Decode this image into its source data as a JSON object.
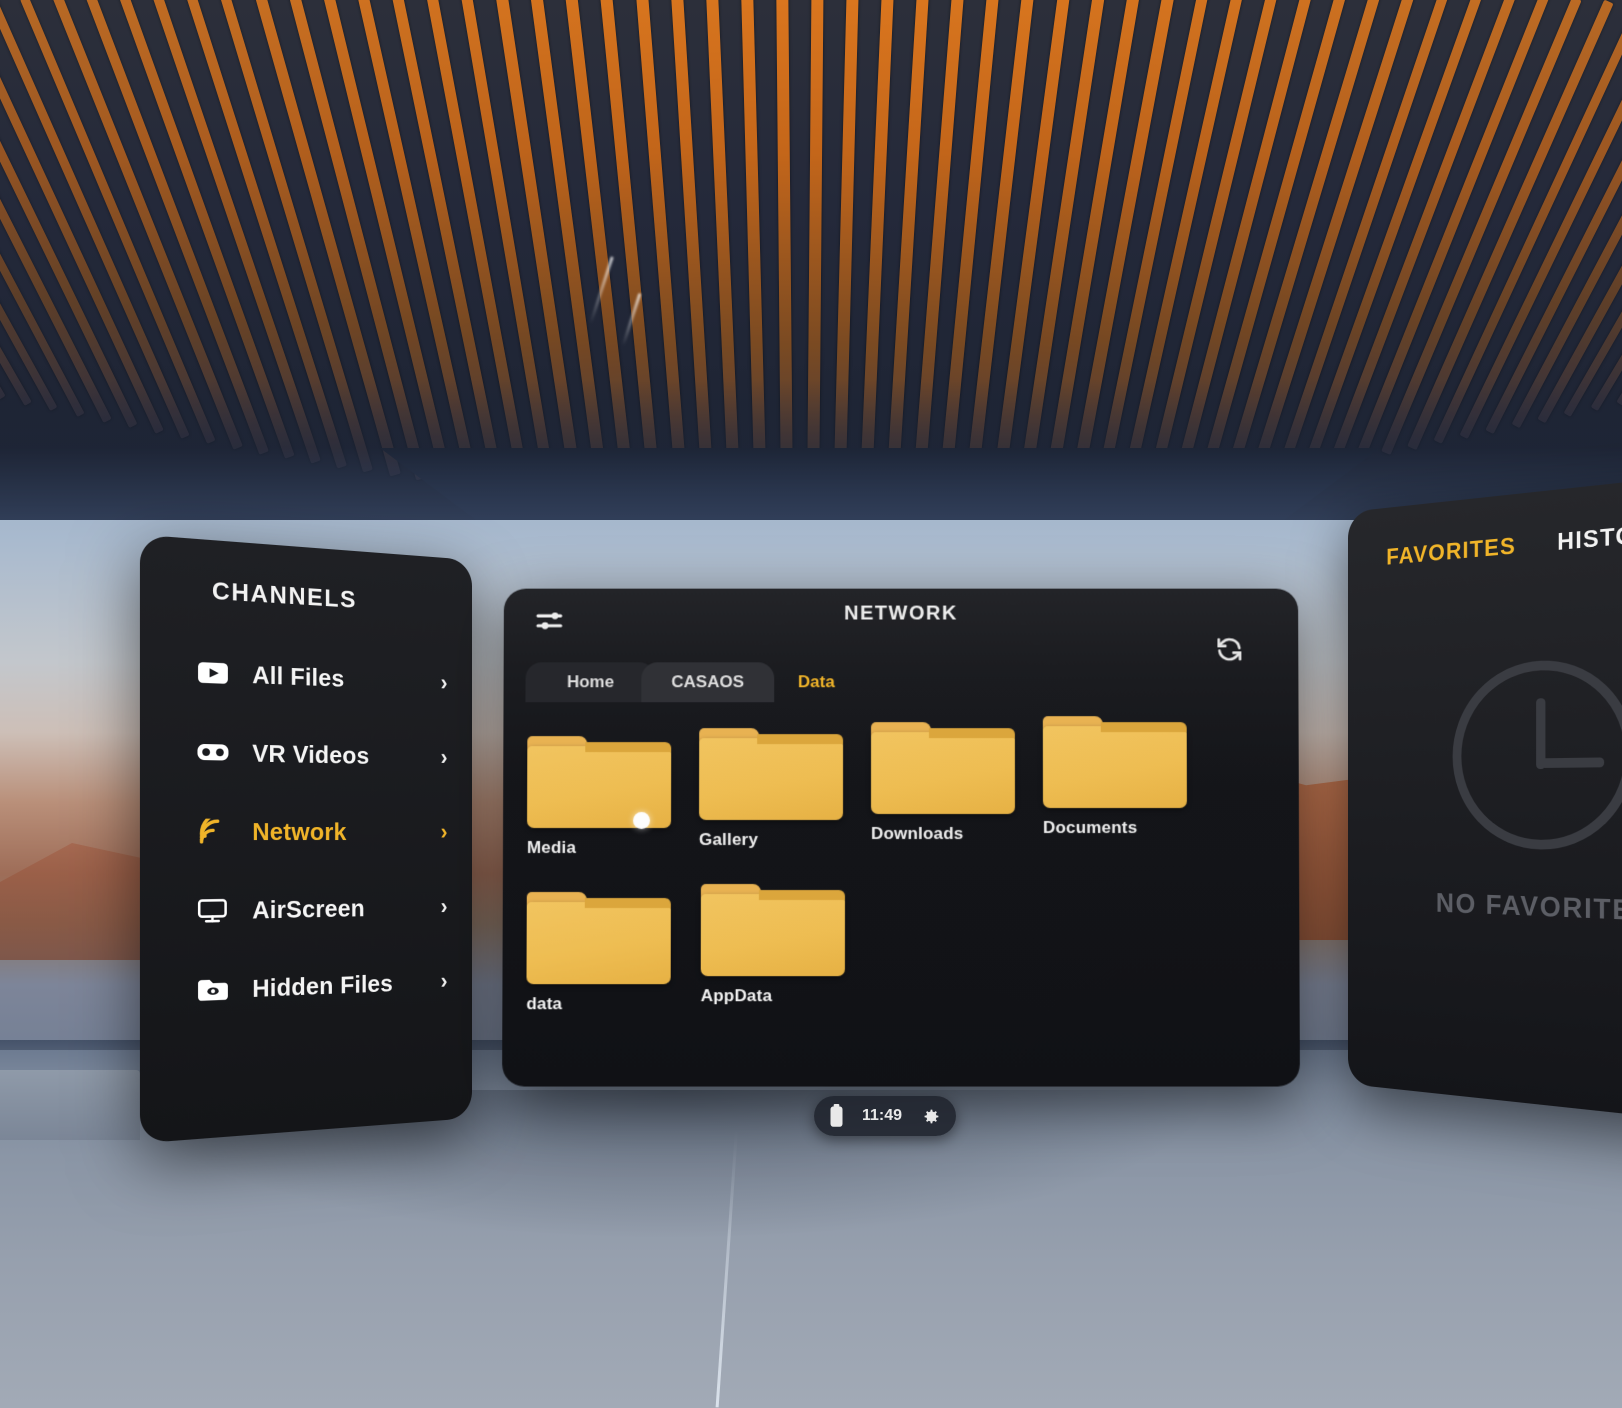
{
  "app": {
    "environment": "vr-home-theater",
    "status_bar": {
      "battery_icon": "battery-icon",
      "time": "11:49",
      "settings_icon": "gear-icon"
    }
  },
  "sidebar": {
    "title": "CHANNELS",
    "items": [
      {
        "label": "All Files",
        "icon": "video-file-icon",
        "chevron": "›",
        "active": false
      },
      {
        "label": "VR Videos",
        "icon": "vr-headset-icon",
        "chevron": "›",
        "active": false
      },
      {
        "label": "Network",
        "icon": "wifi-icon",
        "chevron": "›",
        "active": true
      },
      {
        "label": "AirScreen",
        "icon": "monitor-icon",
        "chevron": "›",
        "active": false
      },
      {
        "label": "Hidden Files",
        "icon": "hidden-folder-icon",
        "chevron": "›",
        "active": false
      }
    ]
  },
  "browser": {
    "title": "NETWORK",
    "filter_icon": "filter-sliders-icon",
    "refresh_icon": "refresh-icon",
    "breadcrumbs": [
      {
        "label": "Home",
        "active": false
      },
      {
        "label": "CASAOS",
        "active": false
      },
      {
        "label": "Data",
        "active": true
      }
    ],
    "rows": [
      [
        {
          "label": "Media",
          "icon": "folder-icon",
          "cursor": true
        },
        {
          "label": "Gallery",
          "icon": "folder-icon",
          "cursor": false
        },
        {
          "label": "Downloads",
          "icon": "folder-icon",
          "cursor": false
        },
        {
          "label": "Documents",
          "icon": "folder-icon",
          "cursor": false
        }
      ],
      [
        {
          "label": "data",
          "icon": "folder-icon",
          "cursor": false
        },
        {
          "label": "AppData",
          "icon": "folder-icon",
          "cursor": false
        }
      ]
    ]
  },
  "favorites": {
    "tabs": [
      {
        "label": "FAVORITES",
        "active": true
      },
      {
        "label": "HISTORY",
        "active": false
      }
    ],
    "empty_icon": "clock-icon",
    "empty_text": "NO FAVORITES"
  },
  "colors": {
    "accent_gold": "#f0b429",
    "folder_yellow": "#eebd52",
    "panel_bg": "#1a1b1f",
    "text_primary": "#f2f2f2",
    "text_muted": "#5c5e65"
  }
}
